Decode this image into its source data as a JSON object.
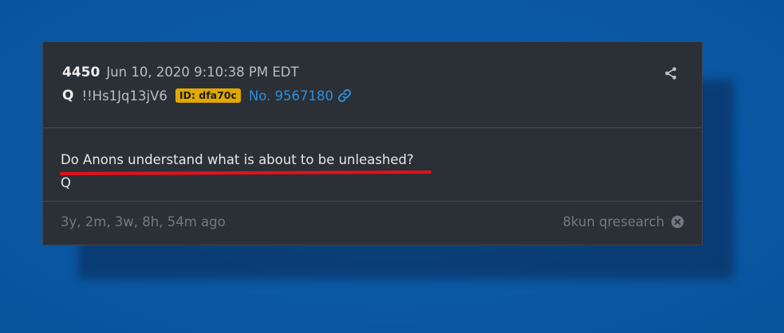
{
  "post": {
    "number": "4450",
    "date": "Jun 10, 2020 9:10:38 PM EDT",
    "author": "Q",
    "tripcode": "!!Hs1Jq13jV6",
    "id_badge": "ID: dfa70c",
    "post_link": "No. 9567180",
    "lines": [
      "Do Anons understand what is about to be unleashed?",
      "Q"
    ],
    "time_ago": "3y, 2m, 3w, 8h, 54m ago",
    "source": "8kun qresearch"
  },
  "icons": {
    "share": "share-icon",
    "link": "link-icon",
    "close": "close-circle-icon"
  },
  "colors": {
    "background": "#0d5da8",
    "card": "#2b2f36",
    "badge": "#e0a800",
    "link": "#2a8fe0",
    "highlight_underline": "#e4101a"
  }
}
